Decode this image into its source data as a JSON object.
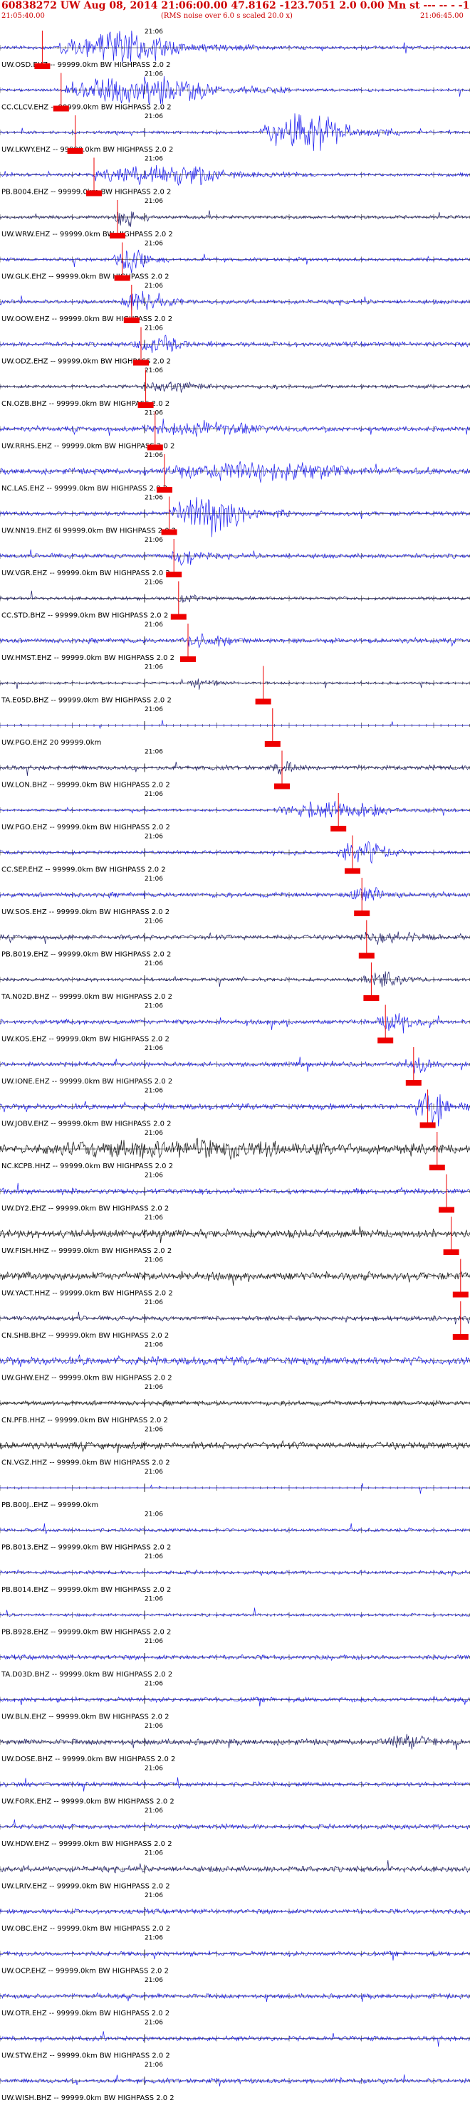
{
  "header": {
    "title": "60838272 UW Aug 08, 2014 21:06:00.00   47.8162  -123.7051  2.0 0.00 Mn st --- -- -   -1",
    "start_time": "21:05:40.00",
    "note": "(RMS noise over 6.0 s scaled 20.0 x)",
    "end_time": "21:06:45.00"
  },
  "colors": {
    "header_red": "#cc0000",
    "pick_red": "#ee0000",
    "trace_blue": "#1a1aee",
    "trace_navy": "#1a1a66",
    "trace_black": "#111111",
    "axis": "#000000"
  },
  "trace_time_label": "21:06",
  "tracks": [
    {
      "label": "UW.OSD.EHZ -- 99999.0km BW  HIGHPASS  2.0  2",
      "color": "blue",
      "pick": 0.09,
      "burst": [
        0.12,
        0.55
      ],
      "amp": 1.3,
      "noise": 0.15
    },
    {
      "label": "CC.CLCV.EHZ -- 99999.0km BW  HIGHPASS  2.0  2",
      "color": "blue",
      "pick": 0.13,
      "burst": [
        0.14,
        0.62
      ],
      "amp": 1.4,
      "noise": 0.12
    },
    {
      "label": "UW.LKWY.EHZ -- 99999.0km BW  HIGHPASS  2.0  2",
      "color": "blue",
      "pick": 0.16,
      "burst": [
        0.55,
        0.85
      ],
      "amp": 1.5,
      "noise": 0.12
    },
    {
      "label": "PB.B004.EHZ -- 99999.0km BW  HIGHPASS  2.0  2",
      "color": "blue",
      "pick": 0.2,
      "burst": [
        0.2,
        0.65
      ],
      "amp": 0.9,
      "noise": 0.15
    },
    {
      "label": "UW.WRW.EHZ -- 99999.0km BW  HIGHPASS  2.0  2",
      "color": "navy",
      "pick": 0.25,
      "burst": [
        0.24,
        0.32
      ],
      "amp": 0.8,
      "noise": 0.15
    },
    {
      "label": "UW.GLK.EHZ -- 99999.0km BW  HIGHPASS  2.0  2",
      "color": "blue",
      "pick": 0.26,
      "burst": [
        0.24,
        0.36
      ],
      "amp": 1.2,
      "noise": 0.15
    },
    {
      "label": "UW.OOW.EHZ -- 99999.0km BW  HIGHPASS  2.0  2",
      "color": "blue",
      "pick": 0.28,
      "burst": [
        0.25,
        0.4
      ],
      "amp": 1.0,
      "noise": 0.18
    },
    {
      "label": "UW.ODZ.EHZ -- 99999.0km BW  HIGHPASS  2.0  2",
      "color": "blue",
      "pick": 0.3,
      "burst": [
        0.28,
        0.45
      ],
      "amp": 0.6,
      "noise": 0.2
    },
    {
      "label": "CN.OZB.BHZ -- 99999.0km BW  HIGHPASS  2.0  2",
      "color": "navy",
      "pick": 0.31,
      "burst": [
        0.3,
        0.5
      ],
      "amp": 0.4,
      "noise": 0.15
    },
    {
      "label": "UW.RRHS.EHZ -- 99999.0km BW  HIGHPASS  2.0  2",
      "color": "blue",
      "pick": 0.33,
      "burst": [
        0.3,
        0.7
      ],
      "amp": 0.5,
      "noise": 0.2
    },
    {
      "label": "NC.LAS.EHZ -- 99999.0km BW  HIGHPASS  2.0  2",
      "color": "blue",
      "pick": 0.35,
      "burst": [
        0.33,
        0.95
      ],
      "amp": 0.7,
      "noise": 0.25
    },
    {
      "label": "UW.NN19.EHZ 6l 99999.0km BW  HIGHPASS  2.0  2",
      "color": "blue",
      "pick": 0.36,
      "burst": [
        0.36,
        0.62
      ],
      "amp": 1.5,
      "noise": 0.2
    },
    {
      "label": "UW.VGR.EHZ -- 99999.0km BW  HIGHPASS  2.0  2",
      "color": "blue",
      "pick": 0.37,
      "burst": [
        0.36,
        0.45
      ],
      "amp": 0.8,
      "noise": 0.2
    },
    {
      "label": "CC.STD.BHZ -- 99999.0km BW  HIGHPASS  2.0  2",
      "color": "navy",
      "pick": 0.38,
      "burst": [
        0.37,
        0.45
      ],
      "amp": 0.4,
      "noise": 0.15
    },
    {
      "label": "UW.HMST.EHZ -- 99999.0km BW  HIGHPASS  2.0  2",
      "color": "blue",
      "pick": 0.4,
      "burst": [
        0.38,
        0.55
      ],
      "amp": 0.5,
      "noise": 0.2
    },
    {
      "label": "TA.E05D.BHZ -- 99999.0km BW  HIGHPASS  2.0  2",
      "color": "navy",
      "pick": 0.56,
      "burst": [
        0.4,
        0.5
      ],
      "amp": 0.4,
      "noise": 0.1
    },
    {
      "label": "UW.PGO.EHZ 20 99999.0km",
      "color": "blue",
      "pick": 0.58,
      "burst": [
        0.5,
        0.5
      ],
      "amp": 0.0,
      "noise": 0.02
    },
    {
      "label": "UW.LON.BHZ -- 99999.0km BW  HIGHPASS  2.0  2",
      "color": "navy",
      "pick": 0.6,
      "burst": [
        0.58,
        0.66
      ],
      "amp": 0.5,
      "noise": 0.2
    },
    {
      "label": "UW.PGO.EHZ -- 99999.0km BW  HIGHPASS  2.0  2",
      "color": "blue",
      "pick": 0.72,
      "burst": [
        0.58,
        0.97
      ],
      "amp": 0.7,
      "noise": 0.1
    },
    {
      "label": "CC.SEP.EHZ -- 99999.0km BW  HIGHPASS  2.0  2",
      "color": "blue",
      "pick": 0.75,
      "burst": [
        0.72,
        0.88
      ],
      "amp": 1.2,
      "noise": 0.15
    },
    {
      "label": "UW.SOS.EHZ -- 99999.0km BW  HIGHPASS  2.0  2",
      "color": "blue",
      "pick": 0.77,
      "burst": [
        0.74,
        0.86
      ],
      "amp": 0.6,
      "noise": 0.2
    },
    {
      "label": "PB.B019.EHZ -- 99999.0km BW  HIGHPASS  2.0  2",
      "color": "navy",
      "pick": 0.78,
      "burst": [
        0.76,
        0.95
      ],
      "amp": 0.5,
      "noise": 0.2
    },
    {
      "label": "TA.N02D.BHZ -- 99999.0km BW  HIGHPASS  2.0  2",
      "color": "navy",
      "pick": 0.79,
      "burst": [
        0.77,
        0.9
      ],
      "amp": 0.7,
      "noise": 0.15
    },
    {
      "label": "UW.KOS.EHZ -- 99999.0km BW  HIGHPASS  2.0  2",
      "color": "blue",
      "pick": 0.82,
      "burst": [
        0.8,
        0.92
      ],
      "amp": 0.9,
      "noise": 0.2
    },
    {
      "label": "UW.IONE.EHZ -- 99999.0km BW  HIGHPASS  2.0  2",
      "color": "blue",
      "pick": 0.88,
      "burst": [
        0.86,
        0.95
      ],
      "amp": 0.7,
      "noise": 0.2
    },
    {
      "label": "UW.JOBV.EHZ -- 99999.0km BW  HIGHPASS  2.0  2",
      "color": "blue",
      "pick": 0.91,
      "burst": [
        0.88,
        1.0
      ],
      "amp": 1.5,
      "noise": 0.25
    },
    {
      "label": "NC.KCPB.HHZ -- 99999.0km BW  HIGHPASS  2.0  2",
      "color": "black",
      "pick": 0.93,
      "burst": [
        0.05,
        1.0
      ],
      "amp": 0.6,
      "noise": 0.35
    },
    {
      "label": "UW.DY2.EHZ -- 99999.0km BW  HIGHPASS  2.0  2",
      "color": "blue",
      "pick": 0.95,
      "burst": [
        0.5,
        0.5
      ],
      "amp": 0.0,
      "noise": 0.25
    },
    {
      "label": "UW.FISH.HHZ -- 99999.0km BW  HIGHPASS  2.0  2",
      "color": "black",
      "pick": 0.96,
      "burst": [
        0.5,
        0.5
      ],
      "amp": 0.0,
      "noise": 0.35
    },
    {
      "label": "UW.YACT.HHZ -- 99999.0km BW  HIGHPASS  2.0  2",
      "color": "black",
      "pick": 0.98,
      "burst": [
        0.5,
        0.5
      ],
      "amp": 0.0,
      "noise": 0.35
    },
    {
      "label": "CN.SHB.BHZ -- 99999.0km BW  HIGHPASS  2.0  2",
      "color": "navy",
      "pick": 0.98,
      "burst": [
        0.5,
        0.5
      ],
      "amp": 0.0,
      "noise": 0.2
    },
    {
      "label": "UW.GHW.EHZ -- 99999.0km BW  HIGHPASS  2.0  2",
      "color": "blue",
      "pick": null,
      "burst": [
        0.5,
        0.5
      ],
      "amp": 0.0,
      "noise": 0.35
    },
    {
      "label": "CN.PFB.HHZ -- 99999.0km BW  HIGHPASS  2.0  2",
      "color": "black",
      "pick": null,
      "burst": [
        0.5,
        0.5
      ],
      "amp": 0.0,
      "noise": 0.2
    },
    {
      "label": "CN.VGZ.HHZ -- 99999.0km BW  HIGHPASS  2.0  2",
      "color": "black",
      "pick": null,
      "burst": [
        0.5,
        0.5
      ],
      "amp": 0.0,
      "noise": 0.3
    },
    {
      "label": "PB.B00J..EHZ -- 99999.0km",
      "color": "blue",
      "pick": null,
      "burst": [
        0.5,
        0.5
      ],
      "amp": 0.0,
      "noise": 0.02
    },
    {
      "label": "PB.B013.EHZ -- 99999.0km BW  HIGHPASS  2.0  2",
      "color": "blue",
      "pick": null,
      "burst": [
        0.5,
        0.5
      ],
      "amp": 0.0,
      "noise": 0.15
    },
    {
      "label": "PB.B014.EHZ -- 99999.0km BW  HIGHPASS  2.0  2",
      "color": "blue",
      "pick": null,
      "burst": [
        0.5,
        0.5
      ],
      "amp": 0.0,
      "noise": 0.15
    },
    {
      "label": "PB.B928.EHZ -- 99999.0km BW  HIGHPASS  2.0  2",
      "color": "blue",
      "pick": null,
      "burst": [
        0.5,
        0.5
      ],
      "amp": 0.0,
      "noise": 0.12
    },
    {
      "label": "TA.D03D.BHZ -- 99999.0km BW  HIGHPASS  2.0  2",
      "color": "blue",
      "pick": null,
      "burst": [
        0.5,
        0.5
      ],
      "amp": 0.0,
      "noise": 0.2
    },
    {
      "label": "UW.BLN.EHZ -- 99999.0km BW  HIGHPASS  2.0  2",
      "color": "blue",
      "pick": null,
      "burst": [
        0.5,
        0.5
      ],
      "amp": 0.0,
      "noise": 0.2
    },
    {
      "label": "UW.DOSE.BHZ -- 99999.0km BW  HIGHPASS  2.0  2",
      "color": "navy",
      "pick": null,
      "burst": [
        0.8,
        0.98
      ],
      "amp": 0.4,
      "noise": 0.25
    },
    {
      "label": "UW.FORK.EHZ -- 99999.0km BW  HIGHPASS  2.0  2",
      "color": "blue",
      "pick": null,
      "burst": [
        0.5,
        0.5
      ],
      "amp": 0.0,
      "noise": 0.2
    },
    {
      "label": "UW.HDW.EHZ -- 99999.0km BW  HIGHPASS  2.0  2",
      "color": "blue",
      "pick": null,
      "burst": [
        0.5,
        0.5
      ],
      "amp": 0.0,
      "noise": 0.2
    },
    {
      "label": "UW.LRIV.EHZ -- 99999.0km BW  HIGHPASS  2.0  2",
      "color": "navy",
      "pick": null,
      "burst": [
        0.5,
        0.5
      ],
      "amp": 0.0,
      "noise": 0.25
    },
    {
      "label": "UW.OBC.EHZ -- 99999.0km BW  HIGHPASS  2.0  2",
      "color": "blue",
      "pick": null,
      "burst": [
        0.5,
        0.5
      ],
      "amp": 0.0,
      "noise": 0.2
    },
    {
      "label": "UW.OCP.EHZ -- 99999.0km BW  HIGHPASS  2.0  2",
      "color": "blue",
      "pick": null,
      "burst": [
        0.5,
        0.5
      ],
      "amp": 0.0,
      "noise": 0.2
    },
    {
      "label": "UW.OTR.EHZ -- 99999.0km BW  HIGHPASS  2.0  2",
      "color": "blue",
      "pick": null,
      "burst": [
        0.5,
        0.5
      ],
      "amp": 0.0,
      "noise": 0.2
    },
    {
      "label": "UW.STW.EHZ -- 99999.0km BW  HIGHPASS  2.0  2",
      "color": "blue",
      "pick": null,
      "burst": [
        0.5,
        0.5
      ],
      "amp": 0.0,
      "noise": 0.2
    },
    {
      "label": "UW.WISH.BHZ -- 99999.0km BW  HIGHPASS  2.0  2",
      "color": "blue",
      "pick": null,
      "burst": [
        0.5,
        0.5
      ],
      "amp": 0.0,
      "noise": 0.2
    }
  ]
}
